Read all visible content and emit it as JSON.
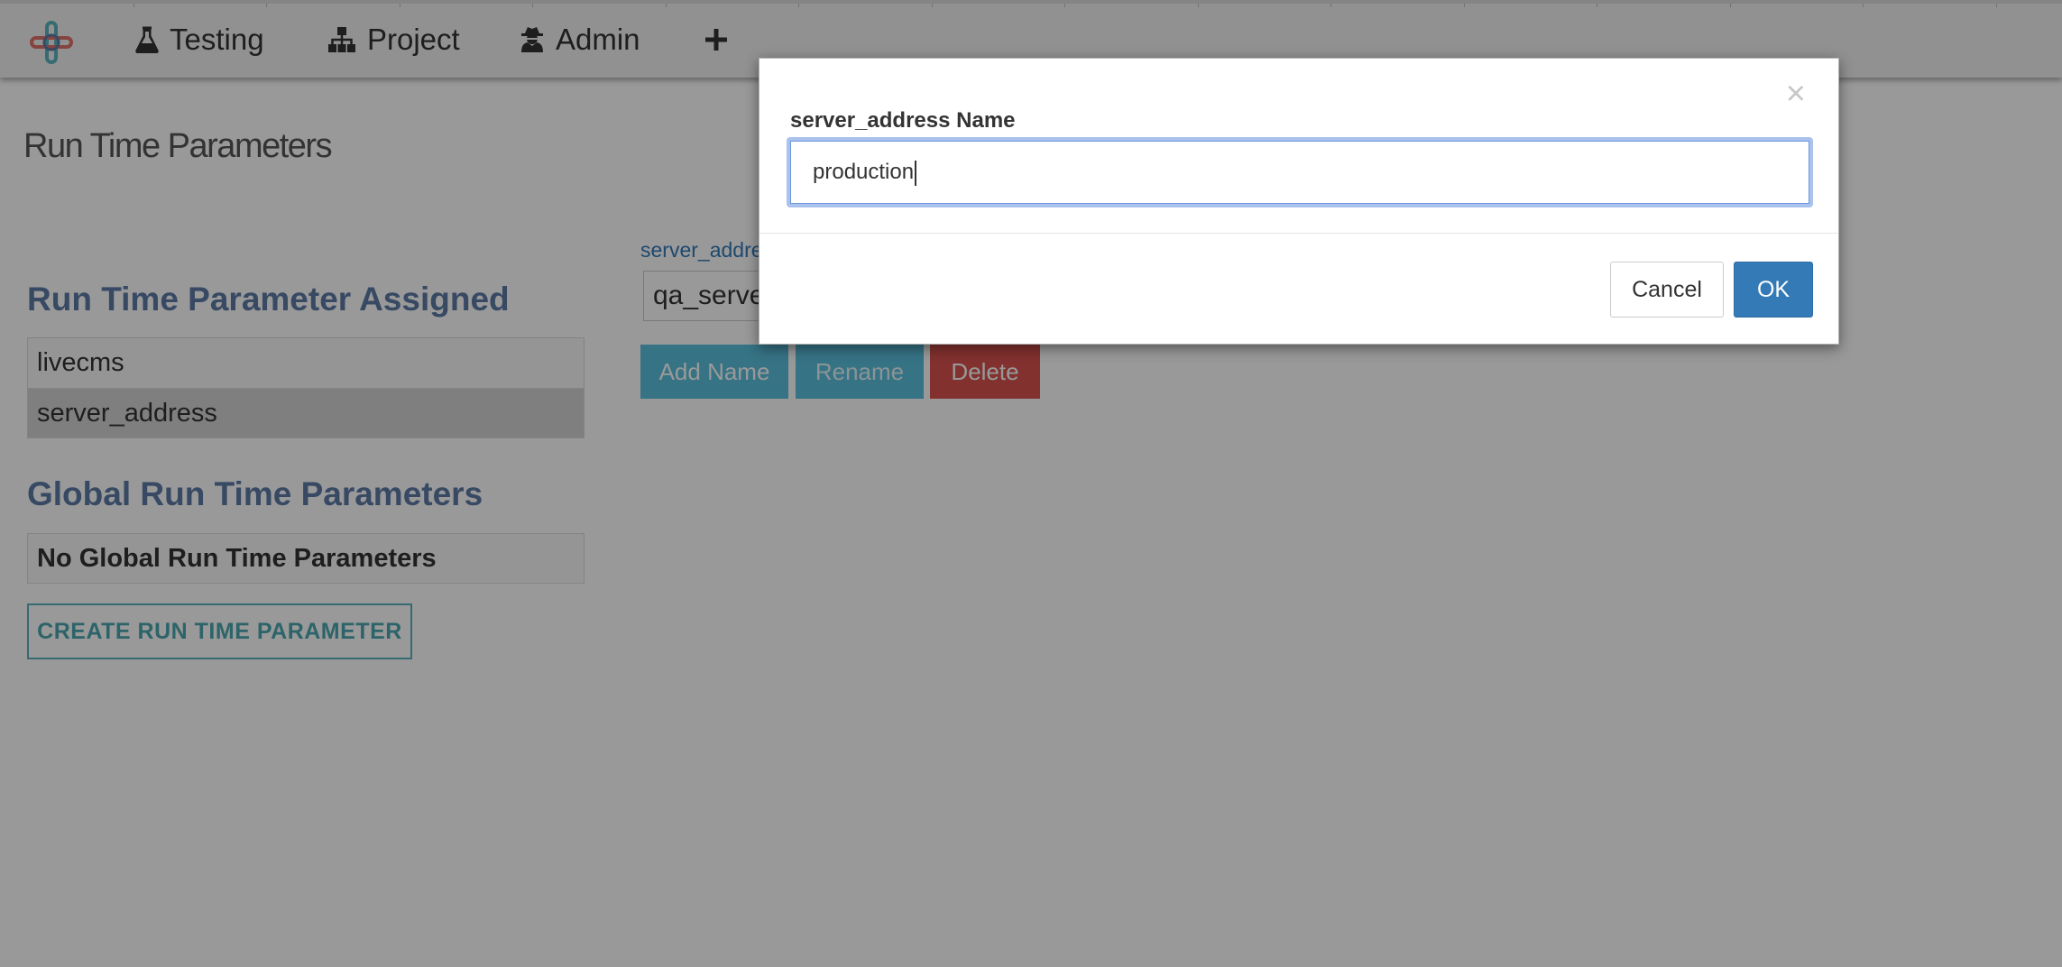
{
  "navbar": {
    "items": [
      {
        "label": "Testing",
        "icon": "flask-icon"
      },
      {
        "label": "Project",
        "icon": "sitemap-icon"
      },
      {
        "label": "Admin",
        "icon": "user-secret-icon"
      }
    ],
    "add_icon": "plus-icon"
  },
  "page": {
    "title": "Run Time Parameters",
    "assigned_heading": "Run Time Parameter Assigned",
    "assigned_items": [
      {
        "label": "livecms",
        "selected": false
      },
      {
        "label": "server_address",
        "selected": true
      }
    ],
    "global_heading": "Global Run Time Parameters",
    "global_empty": "No Global Run Time Parameters",
    "create_button": "CREATE RUN TIME PARAMETER",
    "value_label": "server_address",
    "value_input": "qa_server",
    "buttons": {
      "add": "Add Name",
      "rename": "Rename",
      "delete": "Delete"
    }
  },
  "modal": {
    "close_symbol": "×",
    "label": "server_address Name",
    "input_value": "production",
    "cancel": "Cancel",
    "ok": "OK"
  },
  "colors": {
    "heading": "#5c7aa5",
    "info": "#5bc0de",
    "danger": "#d9534f",
    "primary": "#337ab7",
    "outline": "#5bb5bd"
  }
}
